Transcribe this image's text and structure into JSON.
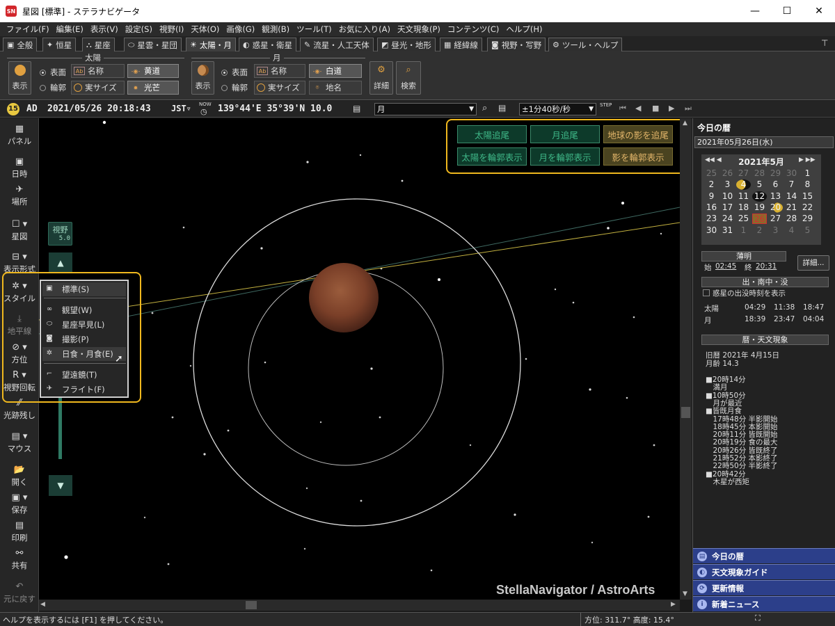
{
  "window": {
    "title": "星図 [標準] - ステラナビゲータ",
    "app_icon_text": "SN",
    "min": "—",
    "max": "☐",
    "close": "✕"
  },
  "menu": [
    "ファイル(F)",
    "編集(E)",
    "表示(V)",
    "設定(S)",
    "視野(I)",
    "天体(O)",
    "画像(G)",
    "観測(B)",
    "ツール(T)",
    "お気に入り(A)",
    "天文現象(P)",
    "コンテンツ(C)",
    "ヘルプ(H)"
  ],
  "tabs": [
    {
      "label": "全般",
      "icon": "▣"
    },
    {
      "label": "恒星",
      "icon": "✦"
    },
    {
      "label": "星座",
      "icon": "⛬"
    },
    {
      "label": "星雲・星団",
      "icon": "⬭"
    },
    {
      "label": "太陽・月",
      "icon": "☀"
    },
    {
      "label": "惑星・衛星",
      "icon": "◐"
    },
    {
      "label": "流星・人工天体",
      "icon": "✎"
    },
    {
      "label": "昼光・地形",
      "icon": "◩"
    },
    {
      "label": "経緯線",
      "icon": "▦"
    },
    {
      "label": "視野・写野",
      "icon": "◙"
    },
    {
      "label": "ツール・ヘルプ",
      "icon": "⚙"
    }
  ],
  "pin_icon": "⊤",
  "ribbon": {
    "sun_group": "太陽",
    "moon_group": "月",
    "show": "表示",
    "surface": "表面",
    "outline": "輪郭",
    "name": "名称",
    "real_size": "実サイズ",
    "ecliptic": "黄道",
    "corona": "光芒",
    "moon_path": "白道",
    "place_name": "地名",
    "detail": "詳細",
    "search": "検索"
  },
  "status": {
    "era": "AD",
    "datetime": "2021/05/26 20:18:43",
    "tz": "JST▿",
    "now": "NOW",
    "location": "139°44'E 35°39'N 10.0",
    "target": "月",
    "step": "±1分40秒/秒",
    "step_label": "STEP"
  },
  "left_tools": [
    {
      "label": "パネル",
      "icon": "▦"
    },
    {
      "label": "日時",
      "icon": "▣"
    },
    {
      "label": "場所",
      "icon": "✈"
    },
    {
      "label": "星図",
      "icon": "☐ ▾"
    },
    {
      "label": "表示形式",
      "icon": "⊟ ▾"
    },
    {
      "label": "スタイル",
      "icon": "✲ ▾"
    },
    {
      "label": "地平線",
      "icon": "⤓"
    },
    {
      "label": "方位",
      "icon": "⊘ ▾"
    },
    {
      "label": "視野回転",
      "icon": "R ▾"
    },
    {
      "label": "光跡残し",
      "icon": "⁄⁄"
    },
    {
      "label": "マウス",
      "icon": "▤ ▾"
    },
    {
      "label": "開く",
      "icon": "📂"
    },
    {
      "label": "保存",
      "icon": "▣ ▾"
    },
    {
      "label": "印刷",
      "icon": "▤"
    },
    {
      "label": "共有",
      "icon": "⚯"
    },
    {
      "label": "元に戻す",
      "icon": "↶"
    }
  ],
  "fov": {
    "label": "視野",
    "value": "5.0"
  },
  "style_menu": [
    {
      "label": "標準(S)",
      "icon": "▣"
    },
    {
      "label": "観望(W)",
      "icon": "∞"
    },
    {
      "label": "星座早見(L)",
      "icon": "⬭"
    },
    {
      "label": "撮影(P)",
      "icon": "◙"
    },
    {
      "label": "日食・月食(E)",
      "icon": "✲"
    },
    {
      "label": "望遠鏡(T)",
      "icon": "⌐"
    },
    {
      "label": "フライト(F)",
      "icon": "✈"
    }
  ],
  "sky_buttons": {
    "track_sun": "太陽追尾",
    "track_moon": "月追尾",
    "track_shadow": "地球の影を追尾",
    "sun_outline": "太陽を輪郭表示",
    "moon_outline": "月を輪郭表示",
    "shadow_outline": "影を輪郭表示"
  },
  "watermark": "StellaNavigator / AstroArts",
  "right_panel": {
    "title": "今日の暦",
    "date": "2021年05月26日(水)",
    "calendar_month": "2021年5月",
    "cal_nav_prev": "◀◀ ◀",
    "cal_nav_next": "▶ ▶▶",
    "calendar_rows": [
      [
        "25",
        "26",
        "27",
        "28",
        "29",
        "30",
        "1"
      ],
      [
        "2",
        "3",
        "4",
        "5",
        "6",
        "7",
        "8"
      ],
      [
        "9",
        "10",
        "11",
        "12",
        "13",
        "14",
        "15"
      ],
      [
        "16",
        "17",
        "18",
        "19",
        "20",
        "21",
        "22"
      ],
      [
        "23",
        "24",
        "25",
        "26",
        "27",
        "28",
        "29"
      ],
      [
        "30",
        "31",
        "1",
        "2",
        "3",
        "4",
        "5"
      ]
    ],
    "twilight_hdr": "薄明",
    "twilight_start_label": "始",
    "twilight_start": "02:45",
    "twilight_end_label": "終",
    "twilight_end": "20:31",
    "detail_btn": "詳細...",
    "rise_hdr": "出・南中・没",
    "planet_checkbox": "惑星の出没時刻を表示",
    "sun_row": [
      "太陽",
      "04:29",
      "11:38",
      "18:47"
    ],
    "moon_row": [
      "月",
      "18:39",
      "23:47",
      "04:04"
    ],
    "events_hdr": "暦・天文現象",
    "old_calendar": "旧暦  2021年 4月15日",
    "moon_age": "月齢  14.3",
    "events": [
      "■20時14分",
      "　満月",
      "■10時50分",
      "　月が最近",
      "■皆既月食",
      "　17時48分 半影開始",
      "　18時45分 本影開始",
      "　20時11分 皆既開始",
      "　20時19分 食の最大",
      "　20時26分 皆既終了",
      "　21時52分 本影終了",
      "　22時50分 半影終了",
      "■20時42分",
      "　木星が西矩"
    ],
    "nav": [
      "今日の暦",
      "天文現象ガイド",
      "更新情報",
      "新着ニュース"
    ]
  },
  "bottom": {
    "help": "ヘルプを表示するには [F1] を押してください。",
    "azimuth": "方位: 311.7°  高度:  15.4°"
  }
}
